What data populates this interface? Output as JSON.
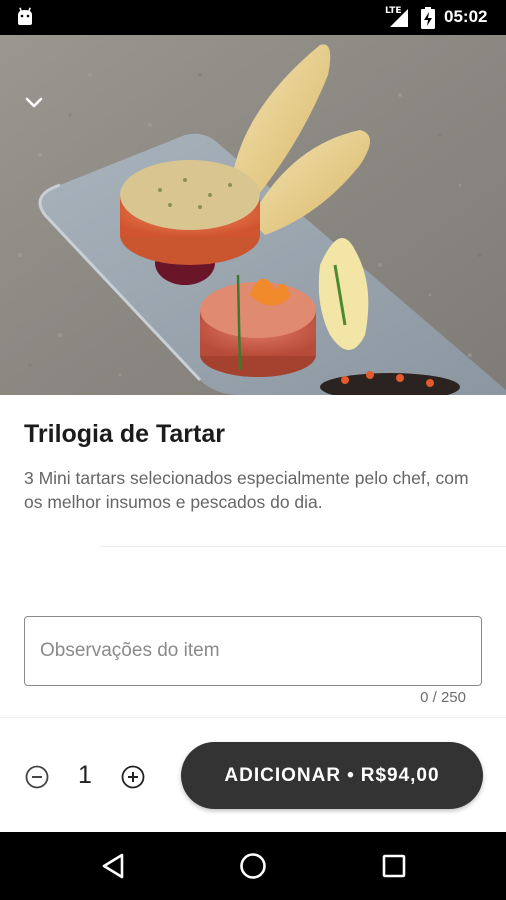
{
  "status_bar": {
    "time": "05:02",
    "network": "LTE",
    "icons": [
      "android-icon",
      "signal-icon",
      "battery-charging-icon"
    ]
  },
  "hero": {
    "image": "tartar-trilogy-photo",
    "back_icon": "chevron-down-icon"
  },
  "product": {
    "title": "Trilogia de Tartar",
    "description": "3 Mini tartars selecionados especialmente pelo chef, com os melhor insumos e pescados do dia."
  },
  "notes": {
    "placeholder": "Observações do item",
    "value": "",
    "counter": "0 / 250"
  },
  "order": {
    "quantity": "1",
    "minus_icon": "minus-circle-icon",
    "plus_icon": "plus-circle-icon",
    "add_label": "ADICIONAR",
    "separator": "•",
    "price": "R$94,00"
  },
  "nav_bar": {
    "icons": [
      "back-triangle-icon",
      "home-circle-icon",
      "recents-square-icon"
    ]
  },
  "colors": {
    "button": "#333333",
    "status_bar": "#000000",
    "text_primary": "#1c1c1c",
    "text_secondary": "#666666"
  }
}
